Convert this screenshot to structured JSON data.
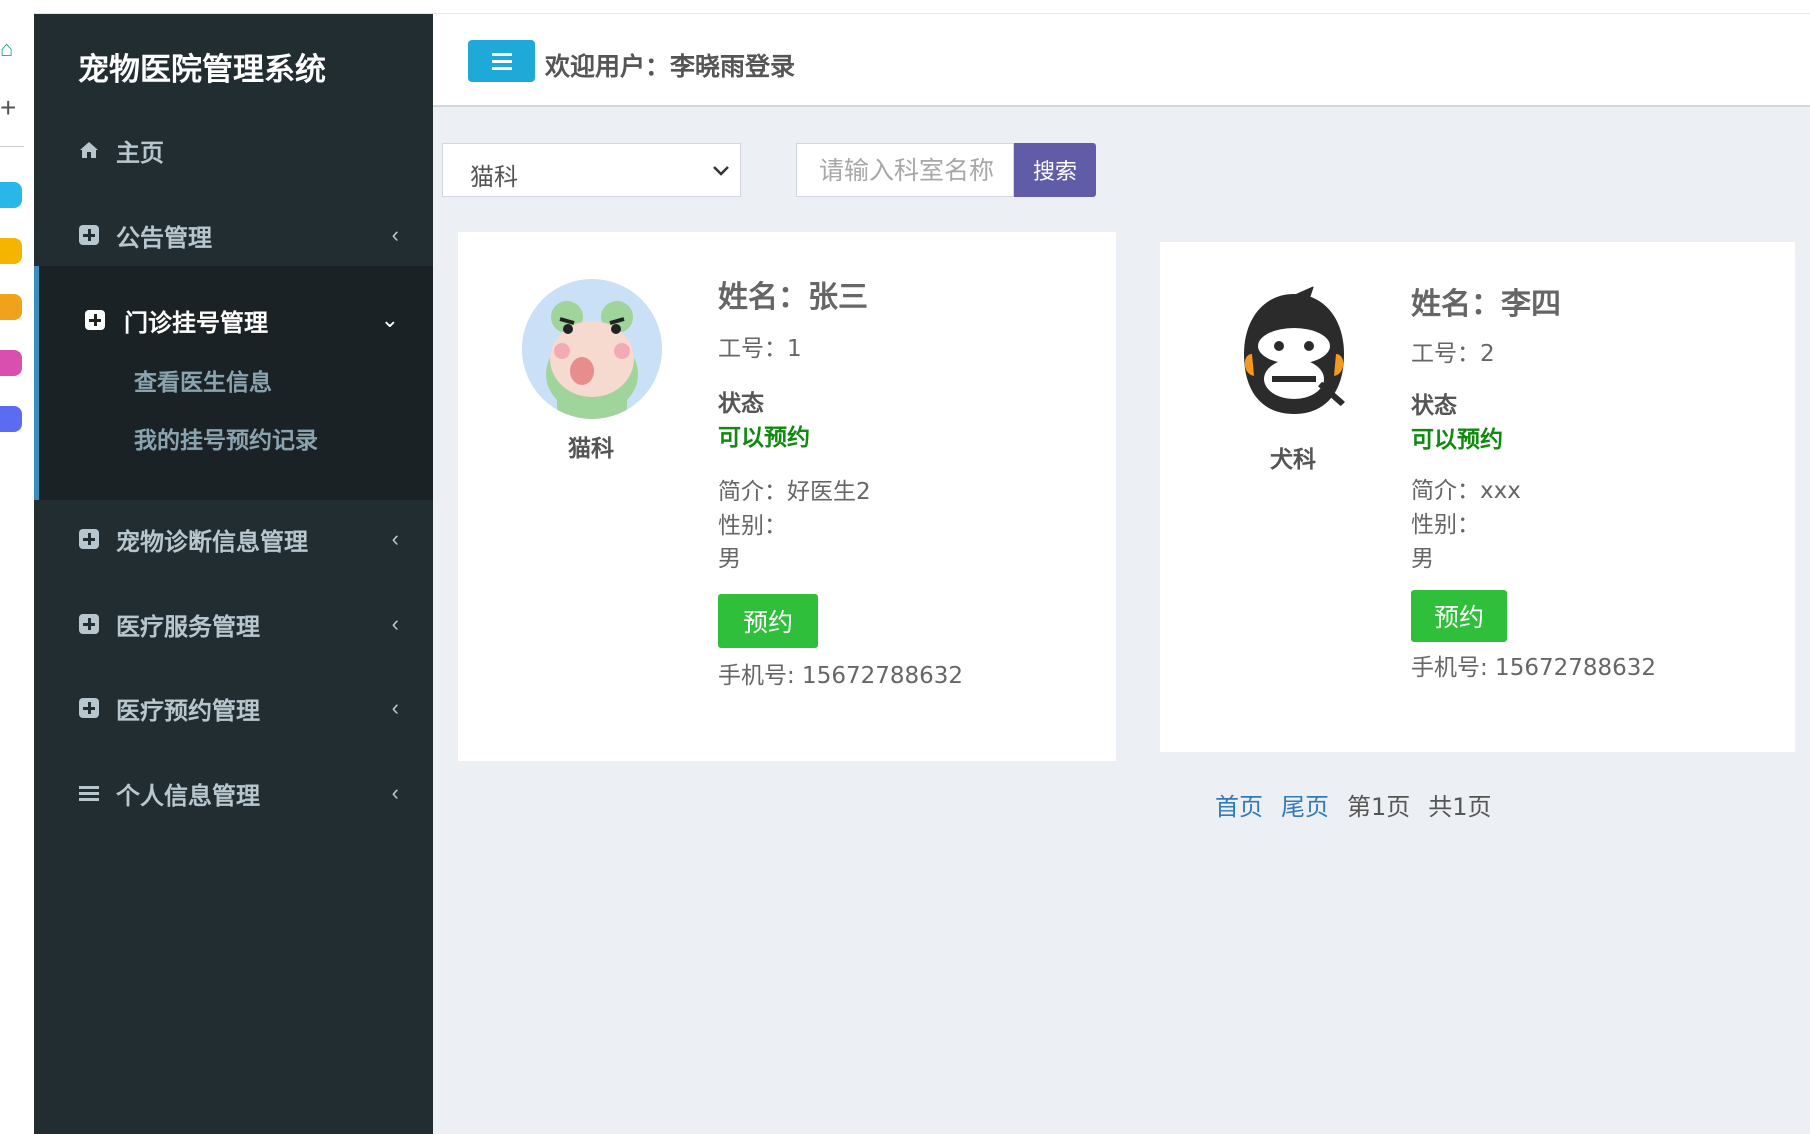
{
  "app": {
    "title": "宠物医院管理系统",
    "welcome": "欢迎用户：李晓雨登录"
  },
  "sidebar": {
    "home": "主页",
    "items": [
      {
        "label": "公告管理",
        "arrow": "‹"
      },
      {
        "label": "门诊挂号管理",
        "arrow": "⌄"
      },
      {
        "label": "宠物诊断信息管理",
        "arrow": "‹"
      },
      {
        "label": "医疗服务管理",
        "arrow": "‹"
      },
      {
        "label": "医疗预约管理",
        "arrow": "‹"
      },
      {
        "label": "个人信息管理",
        "arrow": "‹"
      }
    ],
    "submenu": [
      "查看医生信息",
      "我的挂号预约记录"
    ]
  },
  "filter": {
    "department_selected": "猫科",
    "search_placeholder": "请输入科室名称",
    "search_label": "搜索"
  },
  "doctors": [
    {
      "department": "猫科",
      "name": "姓名：张三",
      "job_no": "工号：1",
      "status_label": "状态",
      "status": "可以预约",
      "intro": "简介：好医生2",
      "gender_label": "性别：",
      "gender": "男",
      "book_label": "预约",
      "phone": "手机号: 15672788632",
      "avatar": "frog-avatar-icon"
    },
    {
      "department": "犬科",
      "name": "姓名：李四",
      "job_no": "工号：2",
      "status_label": "状态",
      "status": "可以预约",
      "intro": "简介：xxx",
      "gender_label": "性别：",
      "gender": "男",
      "book_label": "预约",
      "phone": "手机号: 15672788632",
      "avatar": "gorilla-avatar-icon"
    }
  ],
  "pagination": {
    "first": "首页",
    "last": "尾页",
    "current": "第1页",
    "total": "共1页"
  },
  "colors": {
    "sidebar_bg": "#222d32",
    "accent": "#3c8dbc",
    "toggle": "#1fa9d8",
    "search_btn": "#605ca8",
    "book_btn": "#2fbf3b",
    "status_green": "#0f8a0f"
  }
}
